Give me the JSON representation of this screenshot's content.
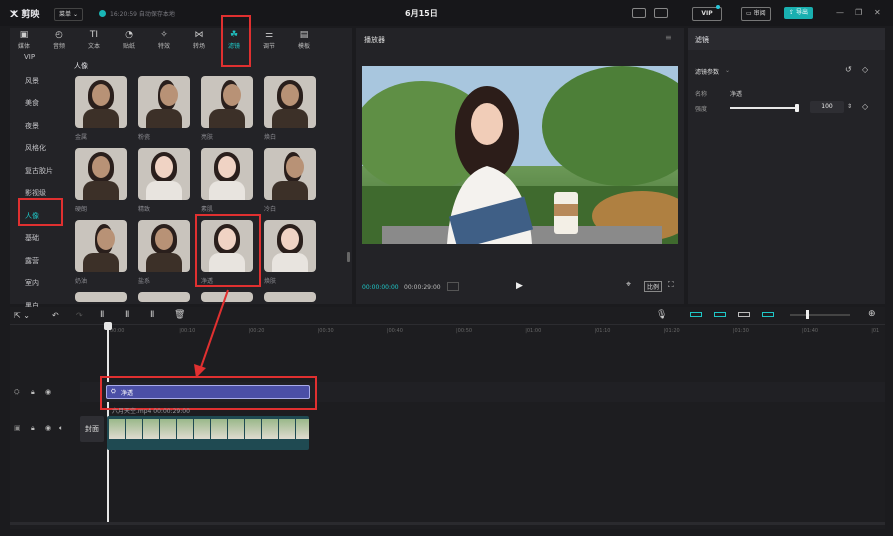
{
  "titlebar": {
    "app_name": "剪映",
    "layout_label": "菜单",
    "autosave_text": "16:20:59 自动保存本地",
    "doc_title": "6月15日",
    "vip_label": "VIP",
    "review_label": "审阅",
    "export_label": "导出"
  },
  "media_tabs": [
    {
      "label": "媒体",
      "icon": "media-icon"
    },
    {
      "label": "音频",
      "icon": "audio-icon"
    },
    {
      "label": "文本",
      "icon": "text-icon"
    },
    {
      "label": "贴纸",
      "icon": "sticker-icon"
    },
    {
      "label": "特效",
      "icon": "effects-icon"
    },
    {
      "label": "转场",
      "icon": "transition-icon"
    },
    {
      "label": "滤镜",
      "icon": "filter-icon",
      "active": true
    },
    {
      "label": "调节",
      "icon": "adjust-icon"
    },
    {
      "label": "模板",
      "icon": "template-icon"
    }
  ],
  "filter_categories": [
    "VIP",
    "风景",
    "美食",
    "夜景",
    "风格化",
    "复古胶片",
    "影视级",
    "人像",
    "基础",
    "露营",
    "室内",
    "黑白"
  ],
  "active_category": "人像",
  "section_title": "人像",
  "filters": [
    {
      "label": "金属",
      "style": "dark"
    },
    {
      "label": "粉瓷",
      "style": "side"
    },
    {
      "label": "亮肤",
      "style": "side"
    },
    {
      "label": "焕白",
      "style": "dark"
    },
    {
      "label": "硬朗",
      "style": "dark"
    },
    {
      "label": "精致",
      "style": "light"
    },
    {
      "label": "素肌",
      "style": "light"
    },
    {
      "label": "冷白",
      "style": "side"
    },
    {
      "label": "奶油",
      "style": "side"
    },
    {
      "label": "盐系",
      "style": "dark"
    },
    {
      "label": "净透",
      "style": "light",
      "selected": true
    },
    {
      "label": "焕肤",
      "style": "light"
    }
  ],
  "player": {
    "title": "播放器",
    "current_time": "00:00:00:00",
    "total_time": "00:00:29:00",
    "ratio_label": "比例"
  },
  "filter_panel": {
    "tab_title": "滤镜",
    "params_label": "滤镜参数",
    "name_label": "名称",
    "name_value": "净透",
    "strength_label": "强度",
    "strength_value": "100",
    "strength_fraction": 1.0
  },
  "timeline": {
    "ruler_ticks": [
      "00:00",
      "|00:10",
      "|00:20",
      "|00:30",
      "|00:40",
      "|00:50",
      "|01:00",
      "|01:10",
      "|01:20",
      "|01:30",
      "|01:40",
      "|01"
    ],
    "filter_clip_label": "净透",
    "video_clip_label": "六月天空.mp4  00:00:29:00",
    "cover_label": "封面"
  },
  "colors": {
    "accent": "#1fc6c6",
    "highlight": "#e03030",
    "filter_clip": "#4b4fa6"
  }
}
